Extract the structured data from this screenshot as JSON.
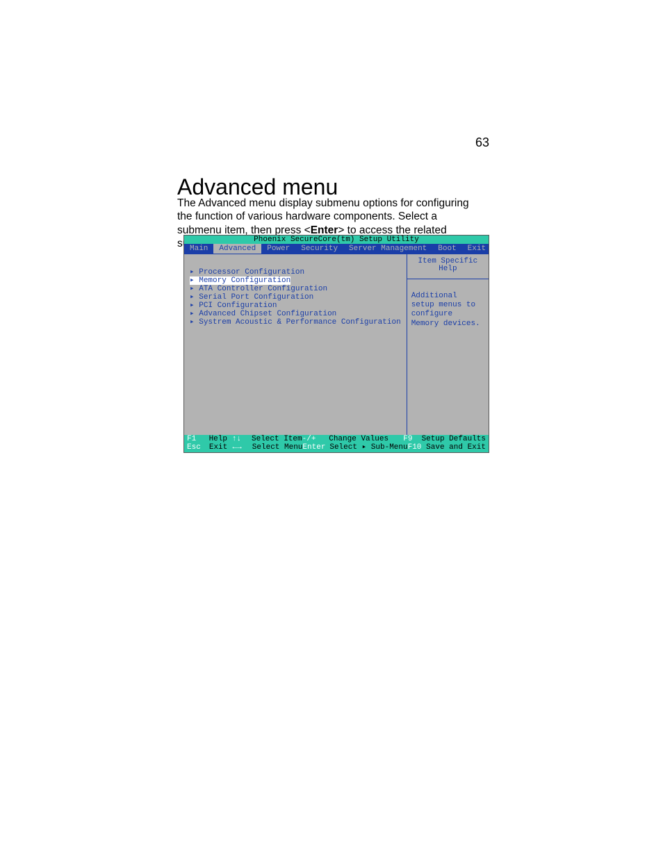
{
  "page_number": "63",
  "heading": "Advanced menu",
  "body_pre": "The Advanced menu display submenu options for configuring the function of various hardware components. Select a submenu item, then press <",
  "body_bold": "Enter",
  "body_post": "> to access the related submenu screen.",
  "bios": {
    "title": "Phoenix SecureCore(tm)  Setup Utility",
    "tabs": [
      "Main",
      "Advanced",
      "Power",
      "Security",
      "Server Management",
      "Boot",
      "Exit"
    ],
    "active_tab_index": 1,
    "menu_items": [
      "Processor Configuration",
      "Memory Configuration",
      "ATA Controller Configuration",
      "Serial Port Configuration",
      "PCI Configuration",
      "Advanced Chipset Configuration",
      "Systrem Acoustic & Performance Configuration"
    ],
    "selected_item_index": 1,
    "help_header": "Item Specific Help",
    "help_body": "Additional setup menus to configure Memory devices.",
    "footer": {
      "row1": [
        {
          "k": "F1",
          "v": "Help"
        },
        {
          "k": "↑↓",
          "v": "Select Item"
        },
        {
          "k": "-/+",
          "v": "Change Values"
        },
        {
          "k": "F9",
          "v": "Setup Defaults"
        }
      ],
      "row2": [
        {
          "k": "Esc",
          "v": "Exit"
        },
        {
          "k": "←→",
          "v": "Select Menu"
        },
        {
          "k": "Enter",
          "v": "Select ▸ Sub-Menu"
        },
        {
          "k": "F10",
          "v": "Save and Exit"
        }
      ]
    }
  }
}
